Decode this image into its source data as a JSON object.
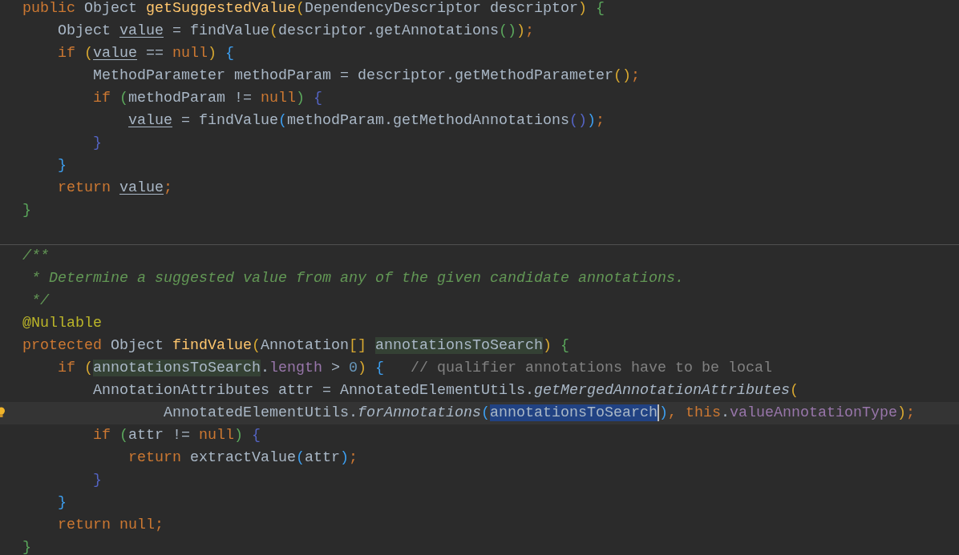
{
  "editor": {
    "methods": [
      {
        "lines": [
          {
            "current": false,
            "tokens": [
              {
                "text": "public",
                "kind": "kw"
              },
              {
                "text": " Object ",
                "kind": "plain"
              },
              {
                "text": "getSuggestedValue",
                "kind": "decl"
              },
              {
                "text": "(",
                "kind": "b1"
              },
              {
                "text": "DependencyDescriptor descriptor",
                "kind": "plain"
              },
              {
                "text": ")",
                "kind": "b1"
              },
              {
                "text": " {",
                "kind": "b2"
              }
            ]
          },
          {
            "current": false,
            "tokens": [
              {
                "text": "    Object ",
                "kind": "plain"
              },
              {
                "text": "value",
                "kind": "var"
              },
              {
                "text": " = findValue",
                "kind": "plain"
              },
              {
                "text": "(",
                "kind": "b1"
              },
              {
                "text": "descriptor.getAnnotations",
                "kind": "plain"
              },
              {
                "text": "()",
                "kind": "b2"
              },
              {
                "text": ")",
                "kind": "b1"
              },
              {
                "text": ";",
                "kind": "kw"
              }
            ]
          },
          {
            "current": false,
            "tokens": [
              {
                "text": "    if",
                "kind": "kw"
              },
              {
                "text": " (",
                "kind": "b1"
              },
              {
                "text": "value",
                "kind": "var"
              },
              {
                "text": " == ",
                "kind": "plain"
              },
              {
                "text": "null",
                "kind": "kw"
              },
              {
                "text": ")",
                "kind": "b1"
              },
              {
                "text": " {",
                "kind": "b3"
              }
            ]
          },
          {
            "current": false,
            "tokens": [
              {
                "text": "        MethodParameter methodParam = descriptor.getMethodParameter",
                "kind": "plain"
              },
              {
                "text": "()",
                "kind": "b1"
              },
              {
                "text": ";",
                "kind": "kw"
              }
            ]
          },
          {
            "current": false,
            "tokens": [
              {
                "text": "        if",
                "kind": "kw"
              },
              {
                "text": " (",
                "kind": "b2"
              },
              {
                "text": "methodParam != ",
                "kind": "plain"
              },
              {
                "text": "null",
                "kind": "kw"
              },
              {
                "text": ")",
                "kind": "b2"
              },
              {
                "text": " {",
                "kind": "b4"
              }
            ]
          },
          {
            "current": false,
            "tokens": [
              {
                "text": "            value",
                "kind": "var"
              },
              {
                "text": " = findValue",
                "kind": "plain"
              },
              {
                "text": "(",
                "kind": "b3"
              },
              {
                "text": "methodParam.getMethodAnnotations",
                "kind": "plain"
              },
              {
                "text": "()",
                "kind": "b4"
              },
              {
                "text": ")",
                "kind": "b3"
              },
              {
                "text": ";",
                "kind": "kw"
              }
            ]
          },
          {
            "current": false,
            "tokens": [
              {
                "text": "        }",
                "kind": "b4"
              }
            ]
          },
          {
            "current": false,
            "tokens": [
              {
                "text": "    }",
                "kind": "b3"
              }
            ]
          },
          {
            "current": false,
            "tokens": [
              {
                "text": "    return",
                "kind": "kw"
              },
              {
                "text": " value",
                "kind": "var"
              },
              {
                "text": ";",
                "kind": "kw"
              }
            ]
          },
          {
            "current": false,
            "tokens": [
              {
                "text": "}",
                "kind": "b2"
              }
            ]
          }
        ]
      },
      {
        "lines": [
          {
            "current": false,
            "tokens": [
              {
                "text": "/**",
                "kind": "doc"
              }
            ]
          },
          {
            "current": false,
            "tokens": [
              {
                "text": " * Determine a suggested value from any of the given candidate annotations.",
                "kind": "doc"
              }
            ]
          },
          {
            "current": false,
            "tokens": [
              {
                "text": " */",
                "kind": "doc"
              }
            ]
          },
          {
            "current": false,
            "tokens": [
              {
                "text": "@Nullable",
                "kind": "ann"
              }
            ]
          },
          {
            "current": false,
            "tokens": [
              {
                "text": "protected",
                "kind": "kw"
              },
              {
                "text": " Object ",
                "kind": "plain"
              },
              {
                "text": "findValue",
                "kind": "decl"
              },
              {
                "text": "(",
                "kind": "b1"
              },
              {
                "text": "Annotation",
                "kind": "plain"
              },
              {
                "text": "[]",
                "kind": "b1"
              },
              {
                "text": " annotationsToSearch",
                "kind": "usage"
              },
              {
                "text": ")",
                "kind": "b1"
              },
              {
                "text": " {",
                "kind": "b2"
              }
            ]
          },
          {
            "current": false,
            "tokens": [
              {
                "text": "    if",
                "kind": "kw"
              },
              {
                "text": " (",
                "kind": "b1"
              },
              {
                "text": "annotationsToSearch",
                "kind": "usage"
              },
              {
                "text": ".",
                "kind": "plain"
              },
              {
                "text": "length",
                "kind": "field"
              },
              {
                "text": " > ",
                "kind": "plain"
              },
              {
                "text": "0",
                "kind": "num"
              },
              {
                "text": ")",
                "kind": "b1"
              },
              {
                "text": " {",
                "kind": "b3"
              },
              {
                "text": "   // qualifier annotations have to be local",
                "kind": "cmt"
              }
            ]
          },
          {
            "current": false,
            "tokens": [
              {
                "text": "        AnnotationAttributes attr = AnnotatedElementUtils.",
                "kind": "plain"
              },
              {
                "text": "getMergedAnnotationAttributes",
                "kind": "italic"
              },
              {
                "text": "(",
                "kind": "b1"
              }
            ]
          },
          {
            "current": true,
            "tokens": [
              {
                "text": "                AnnotatedElementUtils.",
                "kind": "plain"
              },
              {
                "text": "forAnnotations",
                "kind": "italic"
              },
              {
                "text": "(",
                "kind": "b3"
              },
              {
                "text": "annotationsToSearch",
                "kind": "sel"
              },
              {
                "text": ")",
                "kind": "b3"
              },
              {
                "text": ",",
                "kind": "kw"
              },
              {
                "text": " this",
                "kind": "kw"
              },
              {
                "text": ".",
                "kind": "plain"
              },
              {
                "text": "valueAnnotationType",
                "kind": "field"
              },
              {
                "text": ")",
                "kind": "b1"
              },
              {
                "text": ";",
                "kind": "kw"
              }
            ]
          },
          {
            "current": false,
            "tokens": [
              {
                "text": "        if",
                "kind": "kw"
              },
              {
                "text": " (",
                "kind": "b2"
              },
              {
                "text": "attr != ",
                "kind": "plain"
              },
              {
                "text": "null",
                "kind": "kw"
              },
              {
                "text": ")",
                "kind": "b2"
              },
              {
                "text": " {",
                "kind": "b4"
              }
            ]
          },
          {
            "current": false,
            "tokens": [
              {
                "text": "            return",
                "kind": "kw"
              },
              {
                "text": " extractValue",
                "kind": "plain"
              },
              {
                "text": "(",
                "kind": "b3"
              },
              {
                "text": "attr",
                "kind": "plain"
              },
              {
                "text": ")",
                "kind": "b3"
              },
              {
                "text": ";",
                "kind": "kw"
              }
            ]
          },
          {
            "current": false,
            "tokens": [
              {
                "text": "        }",
                "kind": "b4"
              }
            ]
          },
          {
            "current": false,
            "tokens": [
              {
                "text": "    }",
                "kind": "b3"
              }
            ]
          },
          {
            "current": false,
            "tokens": [
              {
                "text": "    return",
                "kind": "kw"
              },
              {
                "text": " null",
                "kind": "kw"
              },
              {
                "text": ";",
                "kind": "kw"
              }
            ]
          },
          {
            "current": false,
            "tokens": [
              {
                "text": "}",
                "kind": "b2"
              }
            ]
          }
        ]
      }
    ]
  }
}
